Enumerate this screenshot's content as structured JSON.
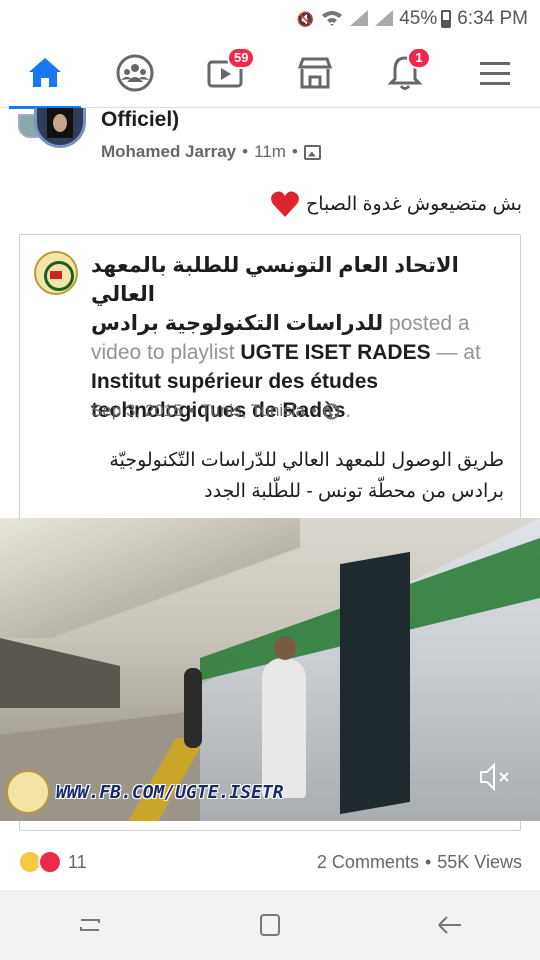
{
  "status_bar": {
    "battery": "45%",
    "time": "6:34 PM"
  },
  "nav": {
    "items": [
      {
        "name": "home",
        "active": true
      },
      {
        "name": "groups"
      },
      {
        "name": "watch",
        "badge": "59"
      },
      {
        "name": "marketplace"
      },
      {
        "name": "notifications",
        "badge": "1"
      },
      {
        "name": "menu"
      }
    ]
  },
  "post": {
    "title": "Officiel)",
    "author": "Mohamed Jarray",
    "time": "11m",
    "text": "بش متضيعوش غدوة الصباح"
  },
  "shared": {
    "org_name_line1": "الاتحاد العام التونسي للطلبة بالمعهد العالي",
    "org_name_line2": "للدراسات التكنولوجية برادس",
    "action1": "posted a",
    "action2": "video to playlist",
    "playlist": "UGTE ISET RADES",
    "dash_at": "— at",
    "place": "Institut supérieur des études technologiques de Radès",
    "period": ".",
    "date": "Sep 3, 2015",
    "location": "Tunis, Tunisia",
    "description_line1": "طريق الوصول للمعهد العالي للدّراسات التّكنولوجيّة",
    "description_line2": "برادس من محطّة تونس - للطّلبة الجدد"
  },
  "video": {
    "watermark": "WWW.FB.COM/UGTE.ISETR"
  },
  "footer": {
    "reactions_count": "11",
    "comments": "2 Comments",
    "views": "55K Views"
  },
  "colors": {
    "accent": "#1877f2",
    "badge": "#f02849"
  }
}
